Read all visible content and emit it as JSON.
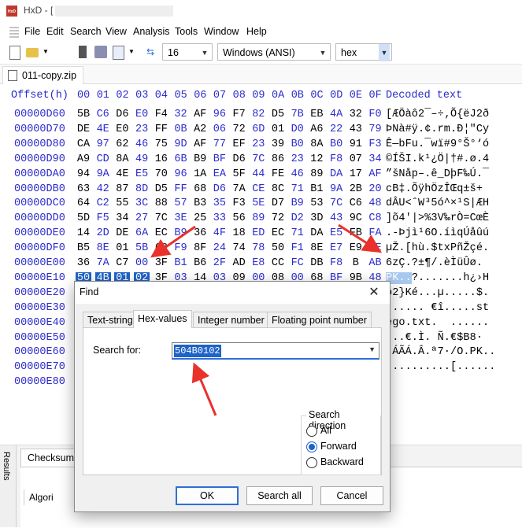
{
  "window": {
    "app_icon": "HxD",
    "title": "HxD - ["
  },
  "menu": [
    "File",
    "Edit",
    "Search",
    "View",
    "Analysis",
    "Tools",
    "Window",
    "Help"
  ],
  "toolbar": {
    "bytes_per_row": "16",
    "charset": "Windows (ANSI)",
    "offset_base": "hex"
  },
  "file_tab": "011-copy.zip",
  "hex_view": {
    "offset_header": "Offset(h)",
    "column_headers": [
      "00",
      "01",
      "02",
      "03",
      "04",
      "05",
      "06",
      "07",
      "08",
      "09",
      "0A",
      "0B",
      "0C",
      "0D",
      "0E",
      "0F"
    ],
    "decoded_header": "Decoded text",
    "rows": [
      {
        "offset": "00000D60",
        "bytes": [
          "5B",
          "C6",
          "D6",
          "E0",
          "F4",
          "32",
          "AF",
          "96",
          "F7",
          "82",
          "D5",
          "7B",
          "EB",
          "4A",
          "32",
          "F0"
        ],
        "text": "[ÆÖàô2¯–÷‚Õ{ëJ2ð"
      },
      {
        "offset": "00000D70",
        "bytes": [
          "DE",
          "4E",
          "E0",
          "23",
          "FF",
          "0B",
          "A2",
          "06",
          "72",
          "6D",
          "01",
          "D0",
          "A6",
          "22",
          "43",
          "79"
        ],
        "text": "ÞNà#ÿ.¢.rm.Ð¦\"Cy"
      },
      {
        "offset": "00000D80",
        "bytes": [
          "CA",
          "97",
          "62",
          "46",
          "75",
          "9D",
          "AF",
          "77",
          "EF",
          "23",
          "39",
          "B0",
          "8A",
          "B0",
          "91",
          "F3"
        ],
        "text": "Ê—bFu.¯wï#9°Š°‘ó"
      },
      {
        "offset": "00000D90",
        "bytes": [
          "A9",
          "CD",
          "8A",
          "49",
          "16",
          "6B",
          "B9",
          "BF",
          "D6",
          "7C",
          "86",
          "23",
          "12",
          "F8",
          "07",
          "34"
        ],
        "text": "©ÍŠI.k¹¿Ö|†#.ø.4"
      },
      {
        "offset": "00000DA0",
        "bytes": [
          "94",
          "9A",
          "4E",
          "E5",
          "70",
          "96",
          "1A",
          "EA",
          "5F",
          "44",
          "FE",
          "46",
          "89",
          "DA",
          "17",
          "AF"
        ],
        "text": "”šNåp–.ê_DþF‰Ú.¯"
      },
      {
        "offset": "00000DB0",
        "bytes": [
          "63",
          "42",
          "87",
          "8D",
          "D5",
          "FF",
          "68",
          "D6",
          "7A",
          "CE",
          "8C",
          "71",
          "B1",
          "9A",
          "2B",
          "20"
        ],
        "text": "cB‡.ÕÿhÖzÎŒq±š+ "
      },
      {
        "offset": "00000DC0",
        "bytes": [
          "64",
          "C2",
          "55",
          "3C",
          "88",
          "57",
          "B3",
          "35",
          "F3",
          "5E",
          "D7",
          "B9",
          "53",
          "7C",
          "C6",
          "48"
        ],
        "text": "dÂU<ˆW³5ó^×¹S|ÆH"
      },
      {
        "offset": "00000DD0",
        "bytes": [
          "5D",
          "F5",
          "34",
          "27",
          "7C",
          "3E",
          "25",
          "33",
          "56",
          "89",
          "72",
          "D2",
          "3D",
          "43",
          "9C",
          "C8"
        ],
        "text": "]õ4'|>%3V‰rÒ=CœÈ"
      },
      {
        "offset": "00000DE0",
        "bytes": [
          "14",
          "2D",
          "DE",
          "6A",
          "EC",
          "B9",
          "36",
          "4F",
          "18",
          "ED",
          "EC",
          "71",
          "DA",
          "E5",
          "FB",
          "FA"
        ],
        "text": ".-Þjì¹6O.íìqÚåûú"
      },
      {
        "offset": "00000DF0",
        "bytes": [
          "B5",
          "8E",
          "01",
          "5B",
          "68",
          "F9",
          "8F",
          "24",
          "74",
          "78",
          "50",
          "F1",
          "8E",
          "E7",
          "E9",
          "2E"
        ],
        "text": "µŽ.[hù.$txPñŽçé."
      },
      {
        "offset": "00000E00",
        "bytes": [
          "36",
          "7A",
          "C7",
          "00",
          "3F",
          "B1",
          "B6",
          "2F",
          "AD",
          "E8",
          "CC",
          "FC",
          "DB",
          "F8",
          "B",
          "AB"
        ],
        "text": "6zÇ.?±¶/.èÌüÛø."
      },
      {
        "offset": "00000E10",
        "bytes": [
          "50",
          "4B",
          "01",
          "02",
          "3F",
          "03",
          "14",
          "03",
          "09",
          "00",
          "08",
          "00",
          "68",
          "BF",
          "9B",
          "48"
        ],
        "text": "PK..?.......h¿›H"
      },
      {
        "offset": "00000E20",
        "bytes": [
          "FE",
          "32",
          "7D",
          "4B",
          "E9",
          "0D",
          "00",
          "00",
          "B5",
          "1B",
          "00",
          "00",
          "09",
          "00",
          "24",
          "00"
        ],
        "text": "þ2}Ké...µ.....$."
      },
      {
        "offset": "00000E30",
        "bytes": [],
        "text": "...... €î.....st"
      },
      {
        "offset": "00000E40",
        "bytes": [],
        "text": "ego.txt.  ......"
      },
      {
        "offset": "00000E50",
        "bytes": [],
        "text": "...€.Ì. Ñ.€$B8·"
      },
      {
        "offset": "00000E60",
        "bytes": [],
        "text": ".ÁÃÁ.Â.ª7·/O.PK.."
      },
      {
        "offset": "00000E70",
        "bytes": [],
        "text": "..........[......"
      },
      {
        "offset": "00000E80",
        "bytes": [],
        "text": ""
      }
    ]
  },
  "results_panel": {
    "side_label": "Results",
    "tab": "Checksum",
    "column": "Algori"
  },
  "find_dialog": {
    "title": "Find",
    "close": "✕",
    "tabs": [
      "Text-string",
      "Hex-values",
      "Integer number",
      "Floating point number"
    ],
    "active_tab": "Hex-values",
    "search_label": "Search for:",
    "search_value": "504B0102",
    "direction_label": "Search direction",
    "directions": [
      "All",
      "Forward",
      "Backward"
    ],
    "selected_direction": "Forward",
    "buttons": {
      "ok": "OK",
      "search_all": "Search all",
      "cancel": "Cancel"
    }
  },
  "colors": {
    "accent": "#1f63c8",
    "offset_blue": "#2b2bcc",
    "annotation": "#e8322b"
  }
}
